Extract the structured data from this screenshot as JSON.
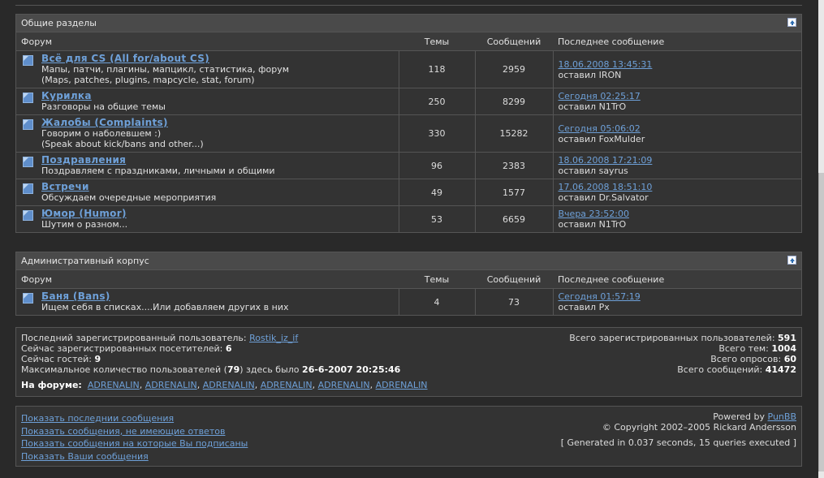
{
  "general": {
    "title": "Общие разделы",
    "headers": {
      "forum": "Форум",
      "topics": "Темы",
      "posts": "Сообщений",
      "last": "Последнее сообщение"
    },
    "forums": [
      {
        "title": "Всё для CS (All for/about CS)",
        "desc1": "Мапы, патчи, плагины, мапцикл, статистика, форум",
        "desc2": "(Maps, patches, plugins, mapcycle, stat, forum)",
        "topics": "118",
        "posts": "2959",
        "last_date": "18.06.2008 13:45:31",
        "last_by": "оставил IRON"
      },
      {
        "title": "Курилка",
        "desc1": "Разговоры на общие темы",
        "desc2": "",
        "topics": "250",
        "posts": "8299",
        "last_date": "Сегодня 02:25:17",
        "last_by": "оставил N1TrO"
      },
      {
        "title": "Жалобы (Complaints)",
        "desc1": "Говорим о наболевшем :)",
        "desc2": "(Speak about kick/bans and other...)",
        "topics": "330",
        "posts": "15282",
        "last_date": "Сегодня 05:06:02",
        "last_by": "оставил FoxMulder"
      },
      {
        "title": "Поздравления",
        "desc1": "Поздравляем с праздниками, личными и общими",
        "desc2": "",
        "topics": "96",
        "posts": "2383",
        "last_date": "18.06.2008 17:21:09",
        "last_by": "оставил sayrus"
      },
      {
        "title": "Встречи",
        "desc1": "Обсуждаем очередные мероприятия",
        "desc2": "",
        "topics": "49",
        "posts": "1577",
        "last_date": "17.06.2008 18:51:10",
        "last_by": "оставил Dr.Salvator"
      },
      {
        "title": "Юмор (Humor)",
        "desc1": "Шутим о разном...",
        "desc2": "",
        "topics": "53",
        "posts": "6659",
        "last_date": "Вчера 23:52:00",
        "last_by": "оставил N1TrO"
      }
    ]
  },
  "admin": {
    "title": "Административный корпус",
    "headers": {
      "forum": "Форум",
      "topics": "Темы",
      "posts": "Сообщений",
      "last": "Последнее сообщение"
    },
    "forums": [
      {
        "title": "Баня (Bans)",
        "desc1": "Ищем себя в списках....Или добавляем других в них",
        "desc2": "",
        "topics": "4",
        "posts": "73",
        "last_date": "Сегодня 01:57:19",
        "last_by": "оставил Px"
      }
    ]
  },
  "stats": {
    "last_user_label": "Последний зарегистрированный пользователь:",
    "last_user": "Rostik_iz_if",
    "reg_online_label": "Сейчас зарегистрированных посетителей:",
    "reg_online": "6",
    "guests_label": "Сейчас гостей:",
    "guests": "9",
    "max_label_pre": "Максимальное количество пользователей (",
    "max_count": "79",
    "max_label_mid": ") здесь было",
    "max_date": "26-6-2007 20:25:46",
    "online_label": "На форуме:",
    "online_users": [
      "ADRENALIN",
      "ADRENALIN",
      "ADRENALIN",
      "ADRENALIN",
      "ADRENALIN",
      "ADRENALIN"
    ],
    "total_users_label": "Всего зарегистрированных пользователей:",
    "total_users": "591",
    "total_topics_label": "Всего тем:",
    "total_topics": "1004",
    "total_polls_label": "Всего опросов:",
    "total_polls": "60",
    "total_posts_label": "Всего сообщений:",
    "total_posts": "41472"
  },
  "footer": {
    "links": [
      "Показать последнии сообщения",
      "Показать сообщения, не имеющие ответов",
      "Показать сообщения на которые Вы подписаны",
      "Показать Ваши сообщения"
    ],
    "powered_pre": "Powered by",
    "powered_link": "PunBB",
    "copyright": "© Copyright 2002–2005 Rickard Andersson",
    "generated": "[ Generated in 0.037 seconds, 15 queries executed ]"
  },
  "colors": {
    "background": "#292929",
    "header": "#4a4a4a",
    "link": "#6ea0d8"
  }
}
